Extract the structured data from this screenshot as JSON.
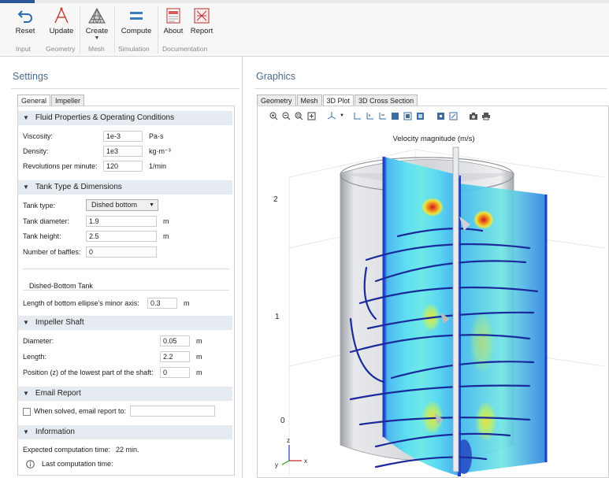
{
  "ribbon": {
    "buttons": [
      {
        "label": "Reset",
        "icon": "reset-icon"
      },
      {
        "label": "Update",
        "icon": "update-icon"
      },
      {
        "label": "Create",
        "icon": "mesh-create-icon"
      },
      {
        "label": "Compute",
        "icon": "compute-icon"
      },
      {
        "label": "About",
        "icon": "about-icon"
      },
      {
        "label": "Report",
        "icon": "report-icon"
      }
    ],
    "groups": [
      "Input",
      "Geometry",
      "Mesh",
      "Simulation",
      "Documentation"
    ]
  },
  "settings": {
    "title": "Settings",
    "tabs": [
      "General",
      "Impeller"
    ],
    "fluid": {
      "header": "Fluid Properties & Operating Conditions",
      "viscosity_label": "Viscosity:",
      "viscosity_value": "1e-3",
      "viscosity_unit": "Pa·s",
      "density_label": "Density:",
      "density_value": "1e3",
      "density_unit": "kg·m⁻³",
      "rpm_label": "Revolutions per minute:",
      "rpm_value": "120",
      "rpm_unit": "1/min"
    },
    "tank": {
      "header": "Tank Type & Dimensions",
      "type_label": "Tank type:",
      "type_value": "Dished bottom",
      "diameter_label": "Tank diameter:",
      "diameter_value": "1.9",
      "diameter_unit": "m",
      "height_label": "Tank height:",
      "height_value": "2.5",
      "height_unit": "m",
      "baffles_label": "Number of baffles:",
      "baffles_value": "0",
      "dished_header": "Dished-Bottom Tank",
      "ellipse_label": "Length of bottom ellipse's minor axis:",
      "ellipse_value": "0.3",
      "ellipse_unit": "m"
    },
    "shaft": {
      "header": "Impeller Shaft",
      "diameter_label": "Diameter:",
      "diameter_value": "0.05",
      "diameter_unit": "m",
      "length_label": "Length:",
      "length_value": "2.2",
      "length_unit": "m",
      "position_label": "Position (z) of the lowest part of the shaft:",
      "position_value": "0",
      "position_unit": "m"
    },
    "email": {
      "header": "Email Report",
      "checkbox_label": "When solved, email report to:",
      "email_value": ""
    },
    "info": {
      "header": "Information",
      "expected_label": "Expected computation time:",
      "expected_value": "22 min.",
      "last_label": "Last computation time:"
    }
  },
  "graphics": {
    "title": "Graphics",
    "tabs": [
      "Geometry",
      "Mesh",
      "3D Plot",
      "3D Cross Section"
    ],
    "active_tab": "3D Plot",
    "plot_title": "Velocity magnitude (m/s)",
    "z_ticks": [
      "2",
      "1",
      "0"
    ],
    "axes": {
      "x": "x",
      "y": "y",
      "z": "z"
    }
  }
}
